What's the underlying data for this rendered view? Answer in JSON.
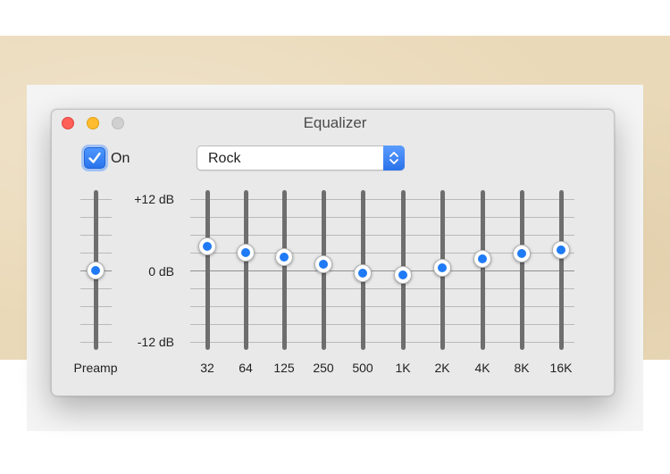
{
  "window": {
    "title": "Equalizer"
  },
  "controls": {
    "on_label": "On",
    "on_checked": true,
    "preset_value": "Rock"
  },
  "scale": {
    "top_label": "+12 dB",
    "mid_label": "0 dB",
    "bottom_label": "-12 dB",
    "min_db": -12,
    "max_db": 12
  },
  "preamp": {
    "label": "Preamp",
    "db": 0
  },
  "bands": [
    {
      "label": "32",
      "db": 4.0
    },
    {
      "label": "64",
      "db": 3.0
    },
    {
      "label": "125",
      "db": 2.2
    },
    {
      "label": "250",
      "db": 1.0
    },
    {
      "label": "500",
      "db": -0.5
    },
    {
      "label": "1K",
      "db": -0.8
    },
    {
      "label": "2K",
      "db": 0.5
    },
    {
      "label": "4K",
      "db": 2.0
    },
    {
      "label": "8K",
      "db": 2.8
    },
    {
      "label": "16K",
      "db": 3.5
    }
  ],
  "colors": {
    "accent": "#1f7af5",
    "close": "#fe5f57",
    "minimize": "#febc2e",
    "zoom": "#d0d0d0"
  }
}
